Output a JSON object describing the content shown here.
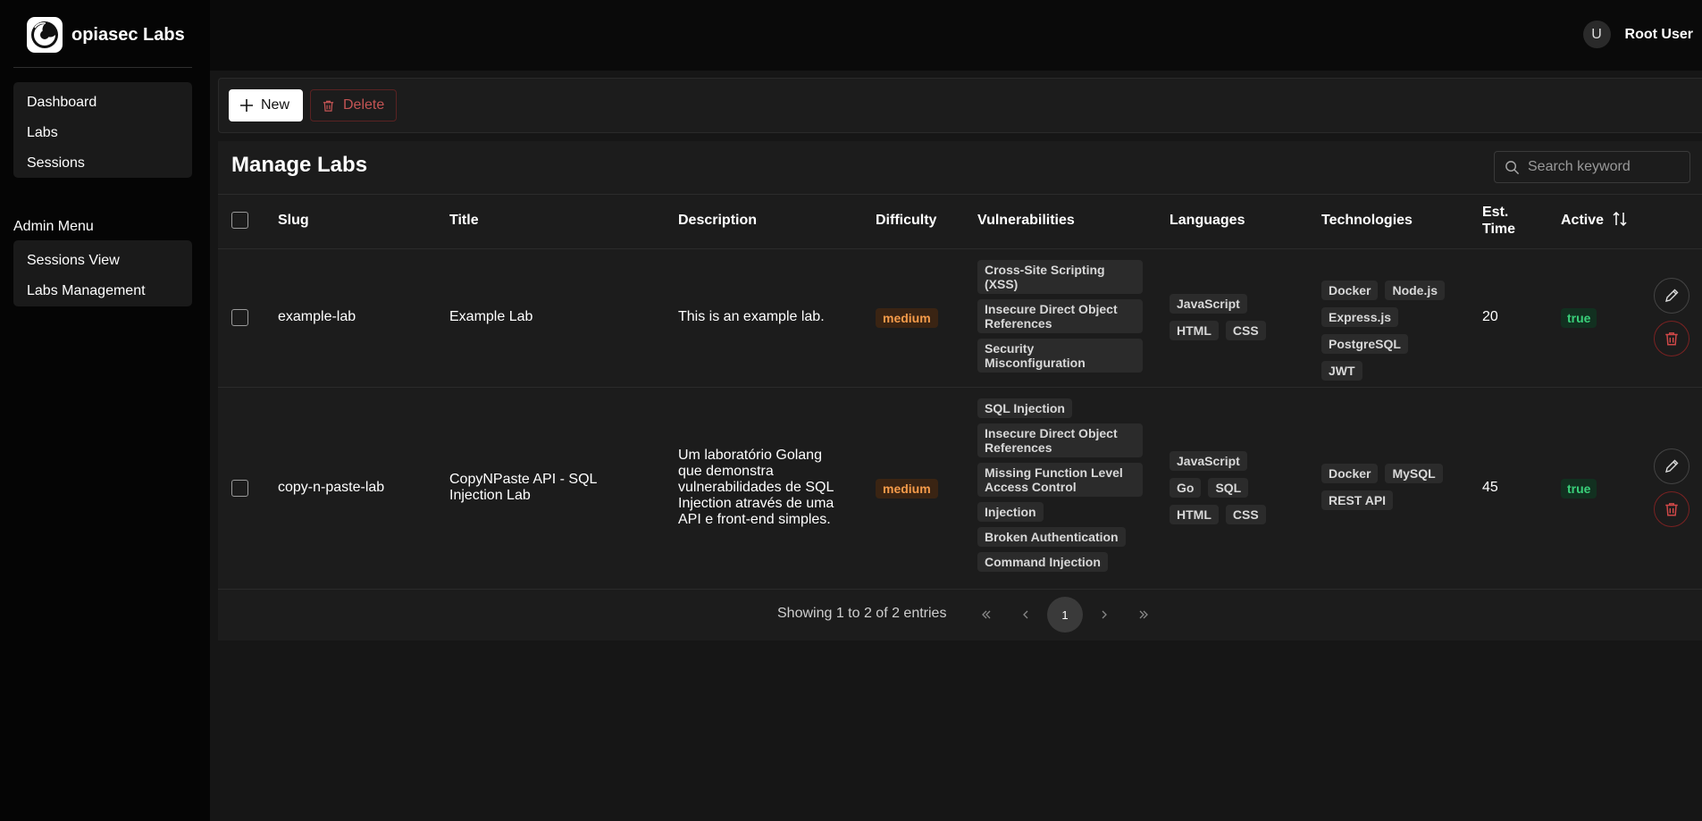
{
  "brand": {
    "name": "opiasec Labs"
  },
  "nav": {
    "main": [
      "Dashboard",
      "Labs",
      "Sessions"
    ],
    "admin_title": "Admin Menu",
    "admin": [
      "Sessions View",
      "Labs Management"
    ]
  },
  "user": {
    "initial": "U",
    "name": "Root User"
  },
  "toolbar": {
    "new_label": "New",
    "delete_label": "Delete"
  },
  "page": {
    "title": "Manage Labs",
    "search_placeholder": "Search keyword"
  },
  "table": {
    "headers": {
      "slug": "Slug",
      "title": "Title",
      "description": "Description",
      "difficulty": "Difficulty",
      "vulnerabilities": "Vulnerabilities",
      "languages": "Languages",
      "technologies": "Technologies",
      "est_time_1": "Est.",
      "est_time_2": "Time",
      "active": "Active"
    },
    "rows": [
      {
        "slug": "example-lab",
        "title": "Example Lab",
        "description": "This is an example lab.",
        "difficulty": "medium",
        "vulnerabilities": [
          "Cross-Site Scripting (XSS)",
          "Insecure Direct Object References",
          "Security Misconfiguration"
        ],
        "languages": [
          "JavaScript",
          "HTML",
          "CSS"
        ],
        "technologies": [
          "Docker",
          "Node.js",
          "Express.js",
          "PostgreSQL",
          "JWT"
        ],
        "est_time": "20",
        "active": "true"
      },
      {
        "slug": "copy-n-paste-lab",
        "title": "CopyNPaste API - SQL Injection Lab",
        "description": "Um laboratório Golang que demonstra vulnerabilidades de SQL Injection através de uma API e front-end simples.",
        "difficulty": "medium",
        "vulnerabilities": [
          "SQL Injection",
          "Insecure Direct Object References",
          "Missing Function Level Access Control",
          "Injection",
          "Broken Authentication",
          "Command Injection"
        ],
        "languages": [
          "JavaScript",
          "Go",
          "SQL",
          "HTML",
          "CSS"
        ],
        "technologies": [
          "Docker",
          "MySQL",
          "REST API"
        ],
        "est_time": "45",
        "active": "true"
      }
    ]
  },
  "pagination": {
    "info": "Showing 1 to 2 of 2 entries",
    "current_page": "1"
  }
}
